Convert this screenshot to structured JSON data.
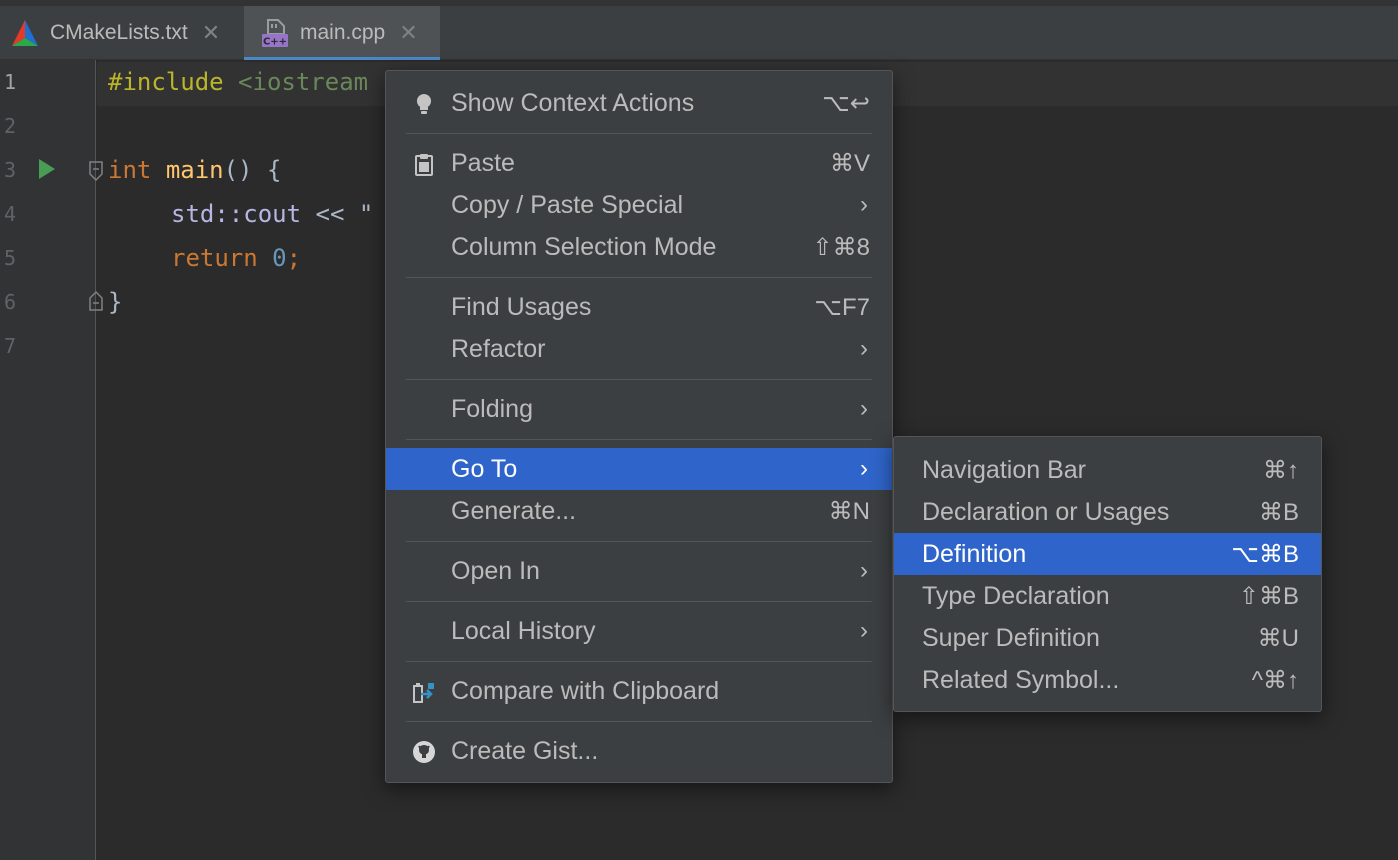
{
  "tabs": [
    {
      "label": "CMakeLists.txt",
      "icon": "cmake-icon",
      "active": false
    },
    {
      "label": "main.cpp",
      "icon": "cpp-file-icon",
      "active": true
    }
  ],
  "editor": {
    "line_numbers": [
      "1",
      "2",
      "3",
      "4",
      "5",
      "6",
      "7"
    ],
    "code": {
      "l1_directive": "#include",
      "l1_include": "<iostream",
      "l3_kw": "int",
      "l3_fn": "main",
      "l3_rest": "() {",
      "l4_ns": "std::cout",
      "l4_rest": " << \"",
      "l5_kw": "return",
      "l5_num": "0",
      "l5_semi": ";",
      "l6_brace": "}"
    }
  },
  "context_menu": {
    "items": [
      {
        "label": "Show Context Actions",
        "shortcut": "⌥↩",
        "icon": "lightbulb-icon"
      },
      {
        "label": "Paste",
        "shortcut": "⌘V",
        "icon": "clipboard-icon"
      },
      {
        "label": "Copy / Paste Special",
        "submenu": true
      },
      {
        "label": "Column Selection Mode",
        "shortcut": "⇧⌘8"
      },
      {
        "label": "Find Usages",
        "shortcut": "⌥F7"
      },
      {
        "label": "Refactor",
        "submenu": true
      },
      {
        "label": "Folding",
        "submenu": true
      },
      {
        "label": "Go To",
        "submenu": true,
        "selected": true
      },
      {
        "label": "Generate...",
        "shortcut": "⌘N"
      },
      {
        "label": "Open In",
        "submenu": true
      },
      {
        "label": "Local History",
        "submenu": true
      },
      {
        "label": "Compare with Clipboard",
        "icon": "compare-icon"
      },
      {
        "label": "Create Gist...",
        "icon": "github-icon"
      }
    ],
    "arrow": "›"
  },
  "goto_submenu": {
    "items": [
      {
        "label": "Navigation Bar",
        "shortcut": "⌘↑"
      },
      {
        "label": "Declaration or Usages",
        "shortcut": "⌘B"
      },
      {
        "label": "Definition",
        "shortcut": "⌥⌘B",
        "selected": true
      },
      {
        "label": "Type Declaration",
        "shortcut": "⇧⌘B"
      },
      {
        "label": "Super Definition",
        "shortcut": "⌘U"
      },
      {
        "label": "Related Symbol...",
        "shortcut": "^⌘↑"
      }
    ]
  },
  "colors": {
    "editor_bg": "#2b2b2b",
    "menu_bg": "#3c3f41",
    "selection": "#2f65ca",
    "keyword": "#cc7832",
    "function": "#ffc66d",
    "number": "#6897bb",
    "tab_underline": "#4a88c7"
  }
}
